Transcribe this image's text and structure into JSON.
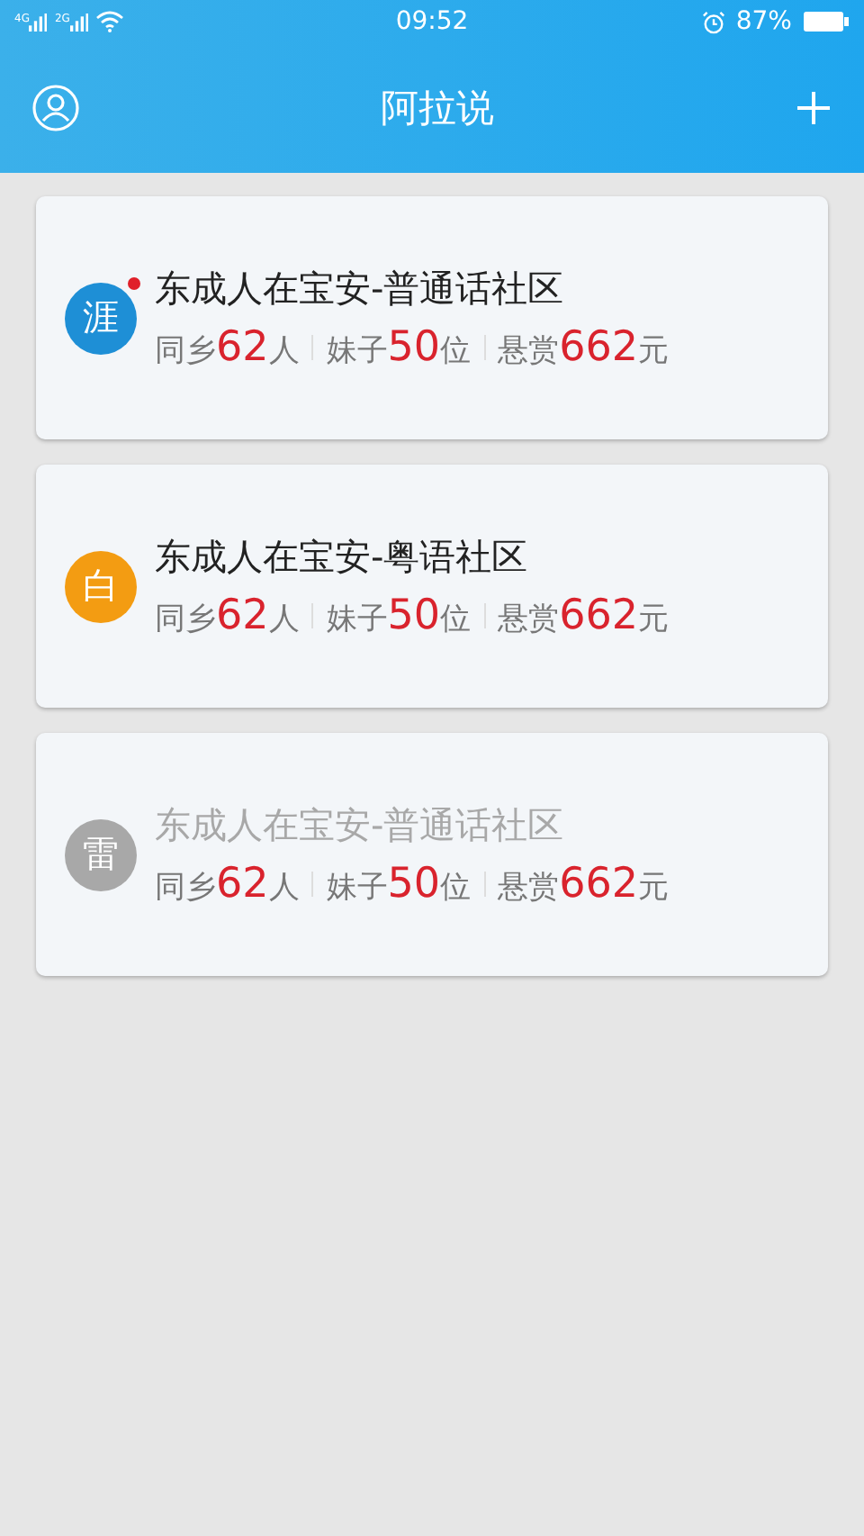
{
  "status_bar": {
    "networks": [
      "4G",
      "2G"
    ],
    "time": "09:52",
    "battery": "87%"
  },
  "header": {
    "title": "阿拉说"
  },
  "communities": [
    {
      "avatar": "涯",
      "color": "#1e8fd6",
      "unread": true,
      "disabled": false,
      "title": "东成人在宝安-普通话社区",
      "stats": [
        {
          "label": "同乡",
          "value": "62",
          "unit": "人"
        },
        {
          "label": "妹子",
          "value": "50",
          "unit": "位"
        },
        {
          "label": "悬赏",
          "value": "662",
          "unit": "元"
        }
      ]
    },
    {
      "avatar": "白",
      "color": "#f39c12",
      "unread": false,
      "disabled": false,
      "title": "东成人在宝安-粤语社区",
      "stats": [
        {
          "label": "同乡",
          "value": "62",
          "unit": "人"
        },
        {
          "label": "妹子",
          "value": "50",
          "unit": "位"
        },
        {
          "label": "悬赏",
          "value": "662",
          "unit": "元"
        }
      ]
    },
    {
      "avatar": "雷",
      "color": "#a8a8a8",
      "unread": false,
      "disabled": true,
      "title": "东成人在宝安-普通话社区",
      "stats": [
        {
          "label": "同乡",
          "value": "62",
          "unit": "人"
        },
        {
          "label": "妹子",
          "value": "50",
          "unit": "位"
        },
        {
          "label": "悬赏",
          "value": "662",
          "unit": "元"
        }
      ]
    }
  ]
}
